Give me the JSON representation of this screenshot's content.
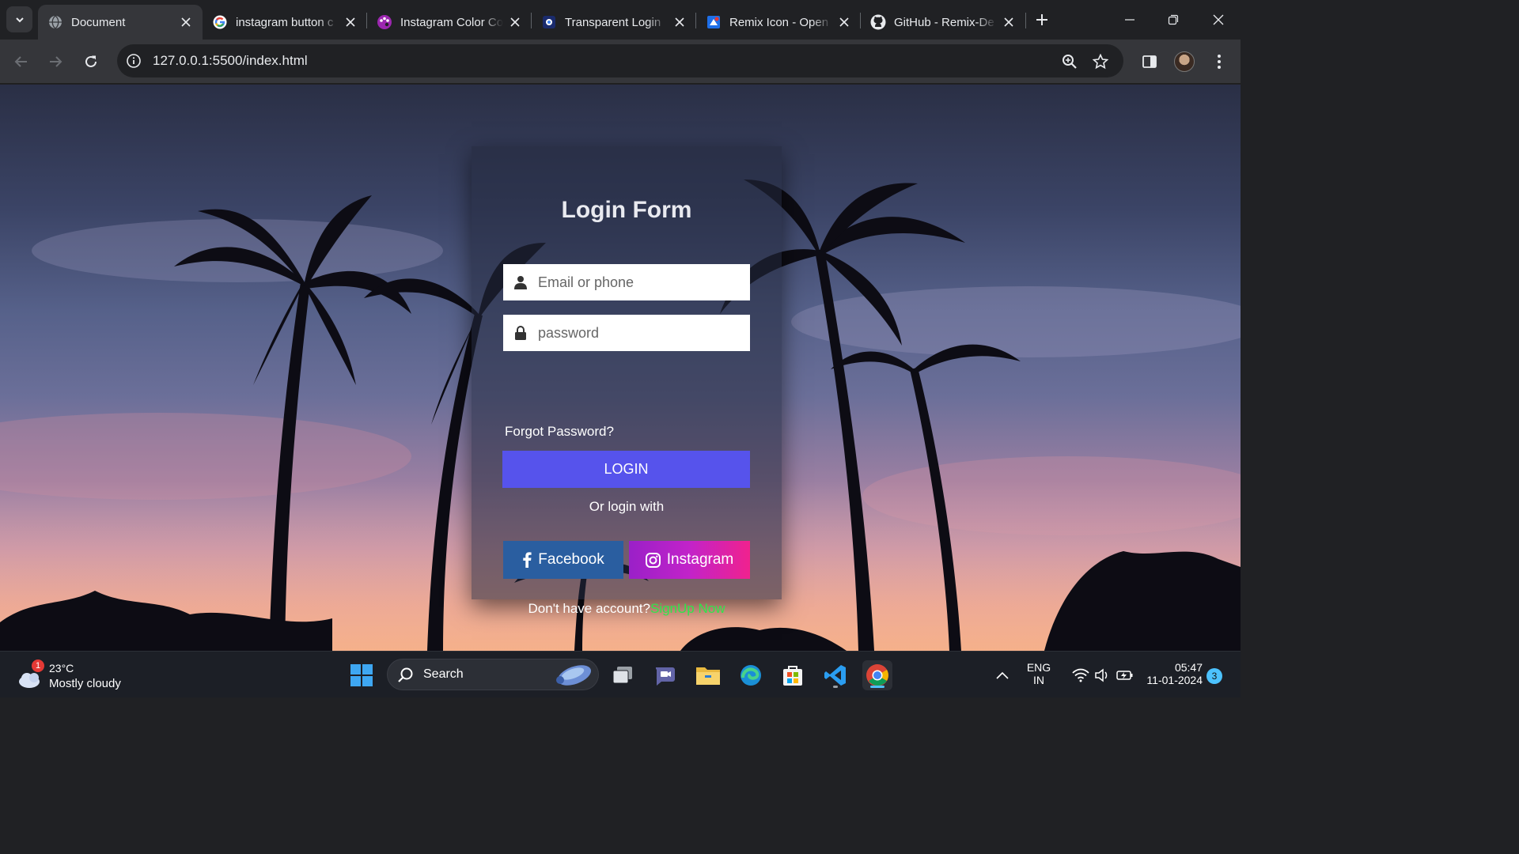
{
  "browser": {
    "tabs": [
      {
        "title": "Document",
        "favicon": "globe-icon",
        "active": true
      },
      {
        "title": "instagram button c",
        "favicon": "google-icon"
      },
      {
        "title": "Instagram Color Co",
        "favicon": "palette-icon"
      },
      {
        "title": "Transparent Login",
        "favicon": "site-icon"
      },
      {
        "title": "Remix Icon - Open",
        "favicon": "remix-icon"
      },
      {
        "title": "GitHub - Remix-De",
        "favicon": "github-icon"
      }
    ],
    "url": "127.0.0.1:5500/index.html"
  },
  "login": {
    "title": "Login Form",
    "email_placeholder": "Email or phone",
    "password_placeholder": "password",
    "forgot": "Forgot Password?",
    "login_button": "LOGIN",
    "or_text": "Or login with",
    "facebook": "Facebook",
    "instagram": "Instagram",
    "no_account": "Don't have account?",
    "signup": "SignUp Now"
  },
  "colors": {
    "login_button": "#5653ec",
    "facebook": "#2a5ea0",
    "instagram_start": "#9a20c8",
    "instagram_end": "#f0228e",
    "signup_link": "#2ee64b"
  },
  "taskbar": {
    "weather_temp": "23°C",
    "weather_cond": "Mostly cloudy",
    "weather_badge": "1",
    "search_label": "Search",
    "lang_top": "ENG",
    "lang_bottom": "IN",
    "time": "05:47",
    "date": "11-01-2024",
    "notifications": "3"
  }
}
